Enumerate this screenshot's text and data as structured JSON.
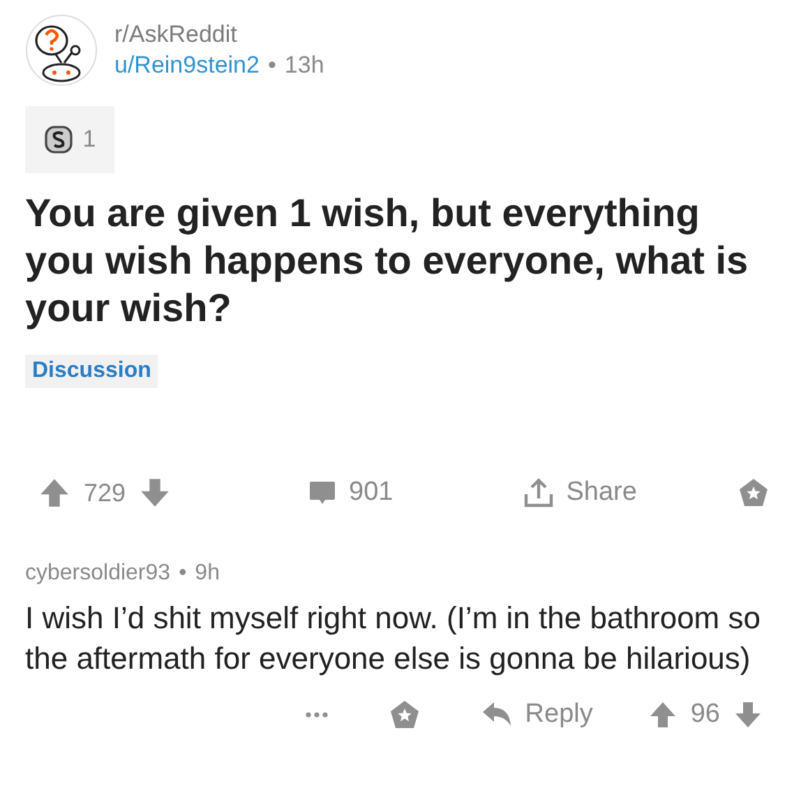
{
  "post": {
    "subreddit": "r/AskReddit",
    "author": "u/Rein9stein2",
    "separator": "•",
    "age": "13h",
    "award_count": "1",
    "title": "You are given 1 wish, but everything you wish happens to everyone, what is your wish?",
    "flair": "Discussion"
  },
  "post_actions": {
    "score": "729",
    "comments": "901",
    "share": "Share"
  },
  "comment": {
    "author": "cybersoldier93",
    "separator": "•",
    "age": "9h",
    "body": "I wish I’d shit myself right now. (I’m in the bathroom so the aftermath for everyone else is gonna be hilarious)",
    "reply": "Reply",
    "score": "96"
  }
}
